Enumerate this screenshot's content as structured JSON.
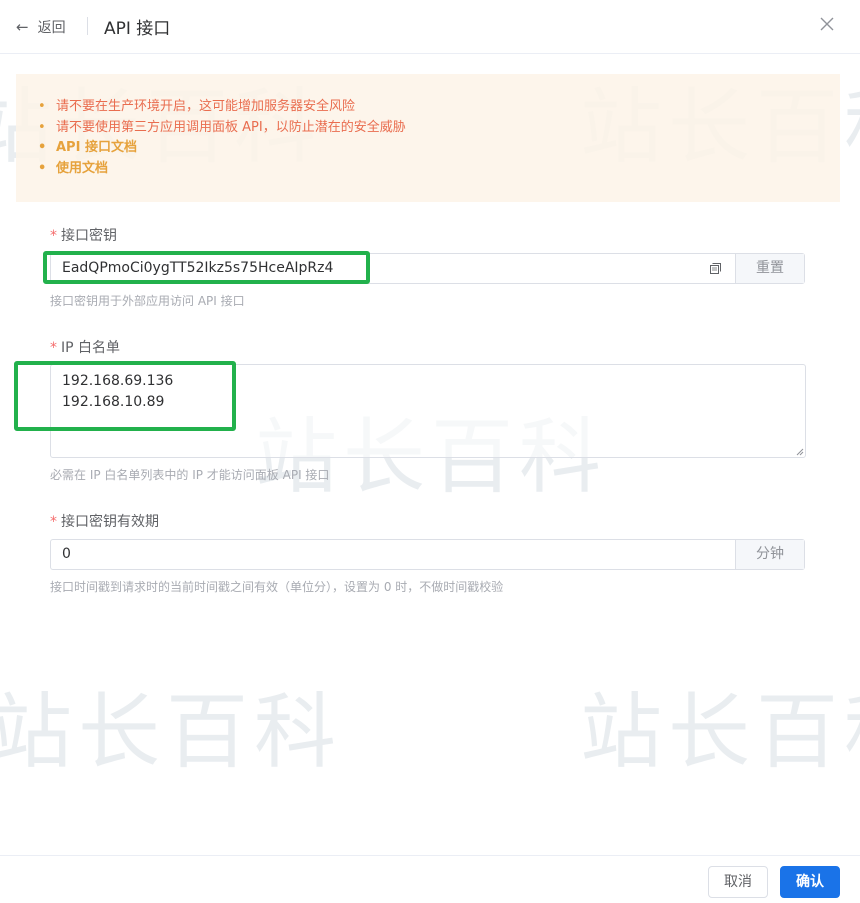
{
  "watermark": "站长百科",
  "header": {
    "back_label": "返回",
    "title": "API 接口"
  },
  "alert": {
    "items": [
      "请不要在生产环境开启，这可能增加服务器安全风险",
      "请不要使用第三方应用调用面板 API，以防止潜在的安全威胁",
      "API 接口文档",
      "使用文档"
    ]
  },
  "form": {
    "api_key": {
      "label": "接口密钥",
      "value": "EadQPmoCi0ygTT52Ikz5s75HceAIpRz4",
      "reset_label": "重置",
      "hint": "接口密钥用于外部应用访问 API 接口"
    },
    "ip_whitelist": {
      "label": "IP 白名单",
      "lines": [
        "192.168.69.136",
        "192.168.10.89"
      ],
      "hint": "必需在 IP 白名单列表中的 IP 才能访问面板 API 接口"
    },
    "validity": {
      "label": "接口密钥有效期",
      "value": "0",
      "unit_label": "分钟",
      "hint": "接口时间戳到请求时的当前时间戳之间有效（单位分），设置为 0 时，不做时间戳校验"
    },
    "required_mark": "*"
  },
  "footer": {
    "cancel_label": "取消",
    "confirm_label": "确认"
  },
  "colors": {
    "accent": "#1a73e8",
    "warning": "#e6a23c",
    "danger_text": "#e96d4f",
    "highlight": "#22b14c"
  }
}
